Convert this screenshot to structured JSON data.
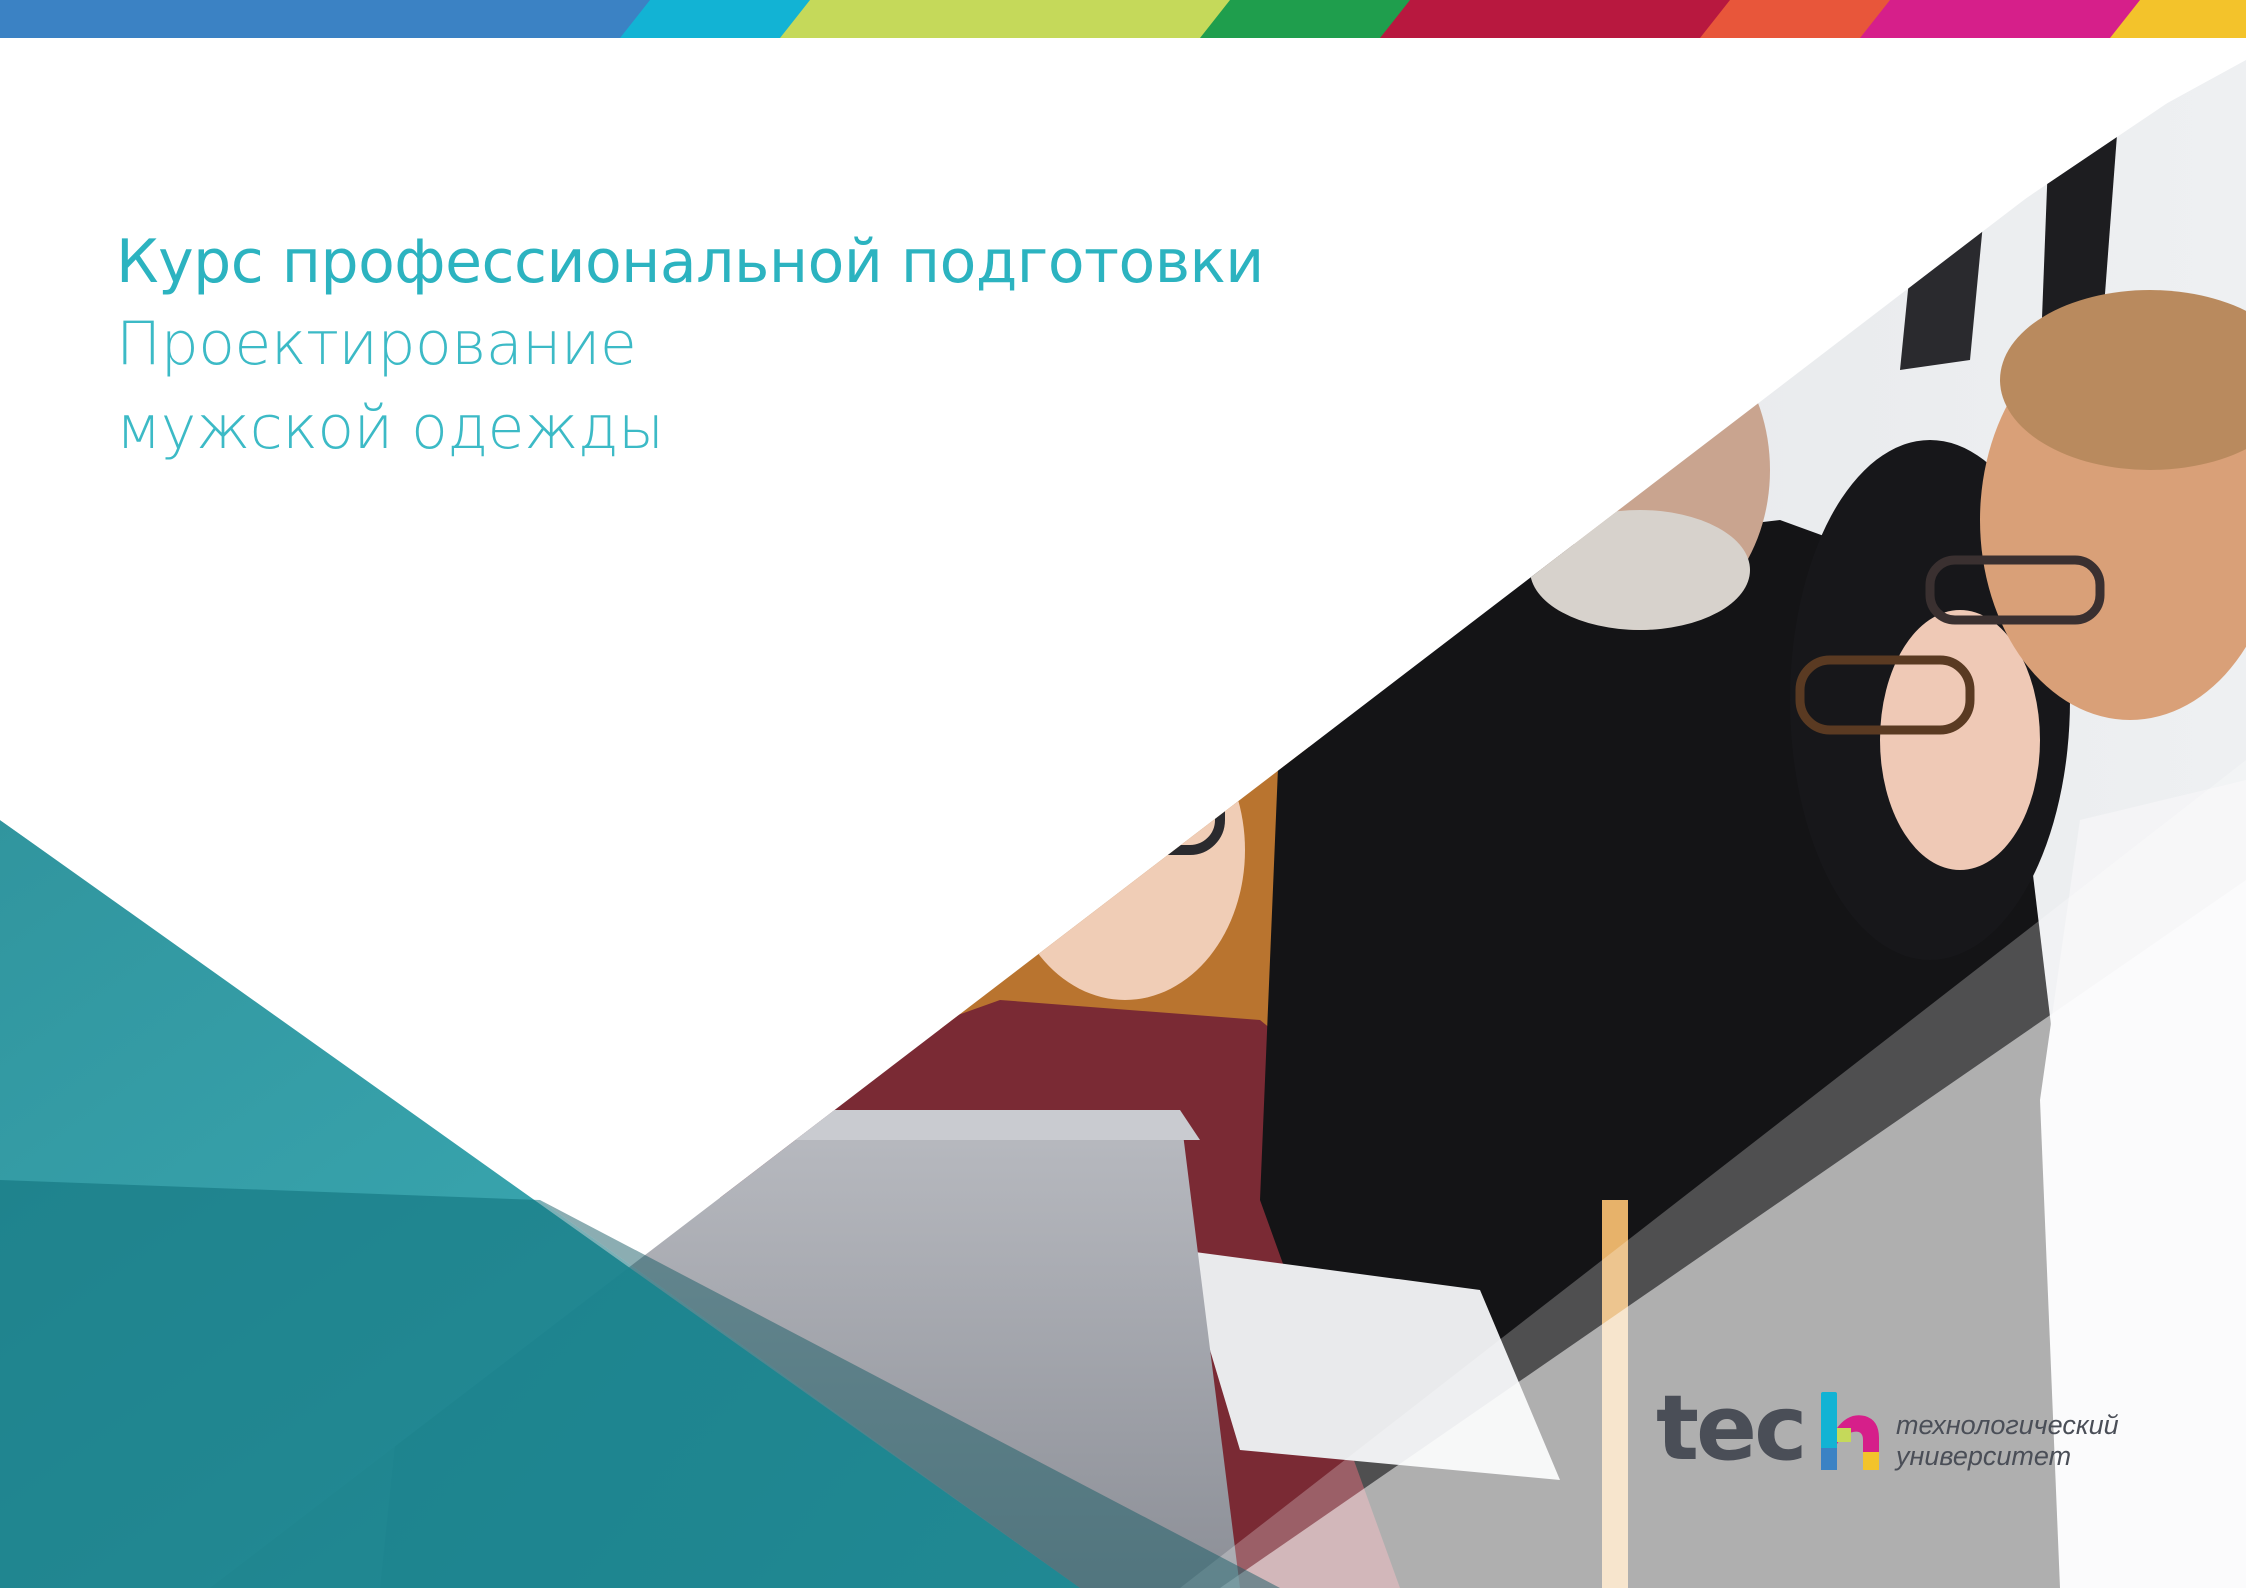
{
  "heading": {
    "line1": "Курс профессиональной подготовки",
    "line2": "Проектирование",
    "line3": "мужской одежды"
  },
  "logo": {
    "word": "tec",
    "tagline_line1": "технологический",
    "tagline_line2": "университет"
  },
  "colors": {
    "accent": "#2cb3c0",
    "teal_panel": "#1e9aa4",
    "logo_text": "#4a4e57",
    "stripe": [
      "#3b82c4",
      "#12b3d4",
      "#c5d95a",
      "#1f9e4d",
      "#b8183f",
      "#e8563a",
      "#d61f8a",
      "#f3c32b"
    ]
  }
}
